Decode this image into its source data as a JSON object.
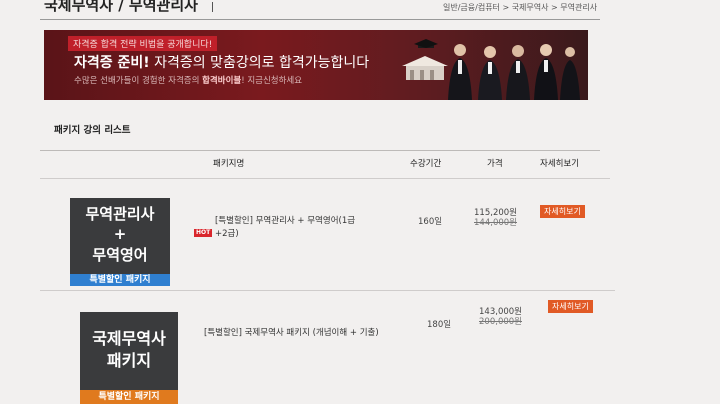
{
  "header": {
    "title": "국제무역사 / 무역관리사",
    "breadcrumb": "일반/금융/컴퓨터 > 국제무역사 > 무역관리사"
  },
  "banner": {
    "badge": "자격증 합격 전략 비법을 공개합니다!",
    "headline_bold": "자격증 준비!",
    "headline_rest": " 자격증의 맞춤강의로 합격가능합니다",
    "sub_prefix": "수많은 선배가들이 경험한 자격증의 ",
    "sub_bold": "합격바이블",
    "sub_suffix": "! 지금신청하세요"
  },
  "list": {
    "section_title": "패키지 강의 리스트",
    "columns": {
      "name": "패키지명",
      "period": "수강기간",
      "price": "가격",
      "detail": "자세히보기"
    },
    "rows": [
      {
        "thumb_line1": "무역관리사",
        "thumb_line2": "+",
        "thumb_line3": "무역영어",
        "thumb_tag": "특별할인 패키지",
        "hot": "HOT",
        "name": "[특별할인] 무역관리사 + 무역영어(1급+2급)",
        "period": "160일",
        "price": "115,200원",
        "price_old": "144,000원",
        "detail": "자세히보기"
      },
      {
        "thumb_line1": "국제무역사",
        "thumb_line2": "패키지",
        "thumb_tag": "특별할인 패키지",
        "name": "[특별할인] 국제무역사 패키지 (개념이해 + 기출)",
        "period": "180일",
        "price": "143,000원",
        "price_old": "200,000원",
        "detail": "자세히보기"
      }
    ]
  },
  "colors": {
    "banner_bg": "#6b181c",
    "accent_orange": "#e15a25",
    "tag_blue": "#2f7fd0",
    "tag_orange": "#e07a1e",
    "thumb_bg": "#3a3b3d",
    "hot_red": "#d9262c"
  }
}
